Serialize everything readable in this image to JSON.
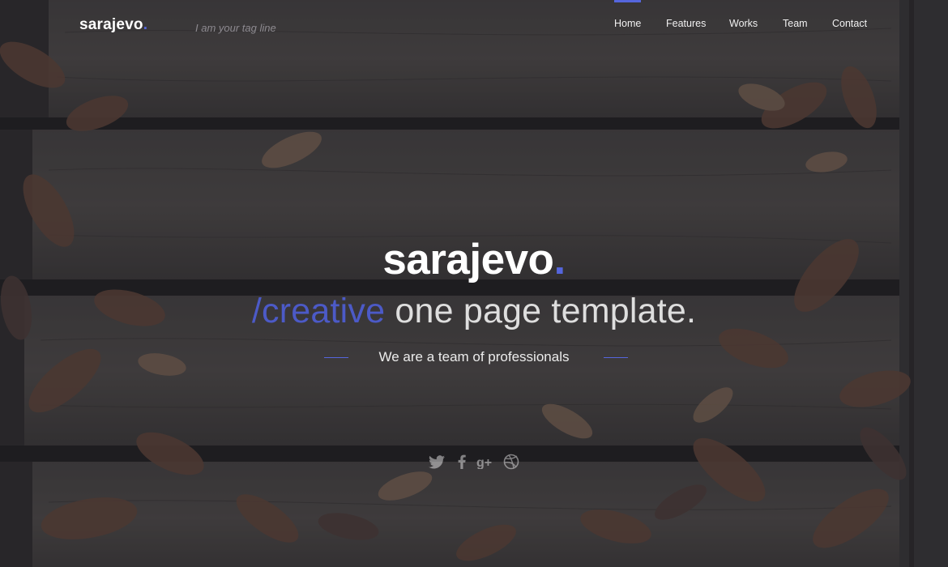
{
  "brand": {
    "name": "sarajevo",
    "dot": "."
  },
  "tagline": "I am your tag line",
  "nav": {
    "items": [
      {
        "label": "Home",
        "active": true
      },
      {
        "label": "Features"
      },
      {
        "label": "Works"
      },
      {
        "label": "Team"
      },
      {
        "label": "Contact"
      }
    ]
  },
  "hero": {
    "title": "sarajevo",
    "title_dot": ".",
    "subtitle_accent": "/creative",
    "subtitle_rest": " one page template.",
    "tagline": "We are a team of professionals"
  },
  "social": [
    {
      "icon": "twitter-icon"
    },
    {
      "icon": "facebook-icon"
    },
    {
      "icon": "google-plus-icon"
    },
    {
      "icon": "dribbble-icon"
    }
  ],
  "colors": {
    "accent": "#5566dd",
    "subtitle_accent": "#4c5ac7",
    "overlay": "rgba(32,30,38,0.42)"
  }
}
